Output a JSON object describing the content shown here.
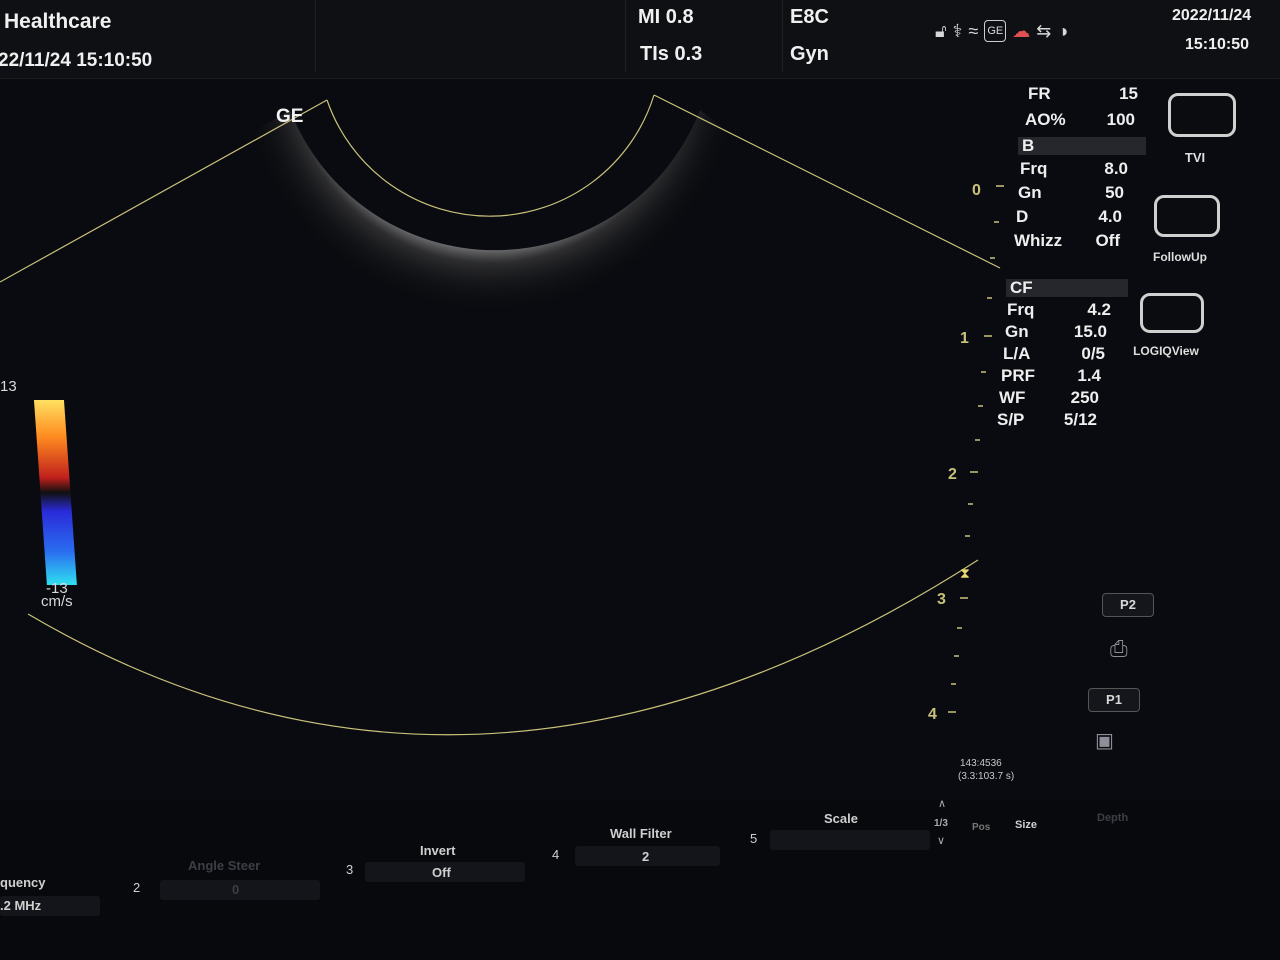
{
  "header": {
    "brand": "Healthcare",
    "datetime_left": "22/11/24 15:10:50",
    "mi": "MI 0.8",
    "tis": "TIs 0.3",
    "probe": "E8C",
    "preset": "Gyn",
    "date": "2022/11/24",
    "time": "15:10:50",
    "status_icons": [
      "lock-icon",
      "probe-icon",
      "wifi-icon",
      "ge-badge-icon",
      "cloud-icon",
      "network-icon",
      "contrast-icon"
    ]
  },
  "image": {
    "ge_mark": "GE",
    "color_bar": {
      "max": "13",
      "min": "-13",
      "unit": "cm/s"
    },
    "depth_labels": [
      "0",
      "1",
      "2",
      "3",
      "4"
    ]
  },
  "params": {
    "general": [
      {
        "label": "FR",
        "value": "15"
      },
      {
        "label": "AO%",
        "value": "100"
      }
    ],
    "b_header": "B",
    "b": [
      {
        "label": "Frq",
        "value": "8.0"
      },
      {
        "label": "Gn",
        "value": "50"
      },
      {
        "label": "D",
        "value": "4.0"
      },
      {
        "label": "Whizz",
        "value": "Off"
      }
    ],
    "cf_header": "CF",
    "cf": [
      {
        "label": "Frq",
        "value": "4.2"
      },
      {
        "label": "Gn",
        "value": "15.0"
      },
      {
        "label": "L/A",
        "value": "0/5"
      },
      {
        "label": "PRF",
        "value": "1.4"
      },
      {
        "label": "WF",
        "value": "250"
      },
      {
        "label": "S/P",
        "value": "5/12"
      }
    ]
  },
  "side_buttons": [
    {
      "label": "TVI"
    },
    {
      "label": "FollowUp"
    },
    {
      "label": "LOGIQView"
    }
  ],
  "small_buttons": {
    "p2": "P2",
    "p1": "P1"
  },
  "cine": {
    "frames": "143:4536",
    "time": "(3.3:103.7 s)"
  },
  "bottom": {
    "frequency_label": "quency",
    "frequency_value": ".2 MHz",
    "n2": "2",
    "angle_steer_label": "Angle Steer",
    "angle_steer_value": "0",
    "n3": "3",
    "invert_label": "Invert",
    "invert_value": "Off",
    "n4": "4",
    "wall_filter_label": "Wall Filter",
    "wall_filter_value": "2",
    "n5": "5",
    "scale_label": "Scale",
    "page": "1/3",
    "pos_label": "Pos",
    "size_label": "Size",
    "depth_label": "Depth"
  }
}
